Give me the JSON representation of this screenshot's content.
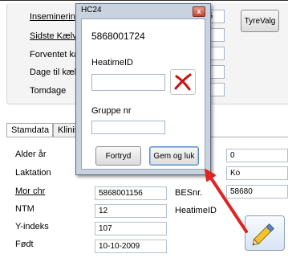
{
  "background_form": {
    "labels": {
      "inseminering": "Inseminering",
      "sidste_kaelv": "Sidste Kælv",
      "forventet": "Forventet ka",
      "dage_til": "Dage til kæl",
      "tomdage": "Tomdage"
    },
    "partial_value": "5",
    "tyrevalg_label": "TyreValg"
  },
  "tabs": [
    {
      "label": "Stamdata"
    },
    {
      "label": "Klinis"
    }
  ],
  "stamdata": {
    "rows": [
      {
        "label": "Alder år"
      },
      {
        "label": "Laktation"
      },
      {
        "label": "Mor chr",
        "value": "5868001156"
      },
      {
        "label": "NTM",
        "value": "12"
      },
      {
        "label": "Y-indeks",
        "value": "107"
      },
      {
        "label": "Født",
        "value": "10-10-2009"
      }
    ],
    "right_values": {
      "val1": "0",
      "val2": "Ko",
      "besnr_label": "BESnr.",
      "besnr_value": "58680",
      "heatime_label": "HeatimeID"
    }
  },
  "dialog": {
    "title": "HC24",
    "close_glyph": "x",
    "animal_number": "5868001724",
    "heatime_label": "HeatimeID",
    "heatime_value": "",
    "gruppe_label": "Gruppe nr",
    "gruppe_value": "",
    "fortryd_label": "Fortryd",
    "gem_label": "Gem og luk"
  },
  "colors": {
    "arrow": "#e02424",
    "clear_icon": "#cc1111"
  }
}
